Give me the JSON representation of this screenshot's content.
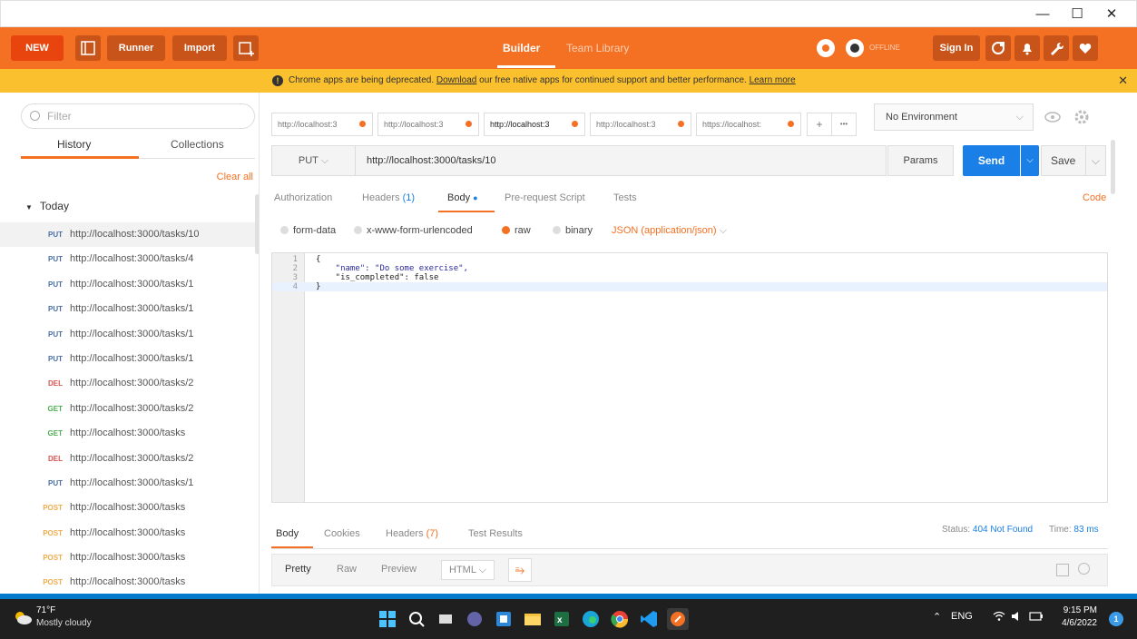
{
  "window": {
    "minimize": "—",
    "maximize": "☐",
    "close": "✕"
  },
  "toolbar": {
    "new_label": "NEW",
    "runner_label": "Runner",
    "import_label": "Import",
    "builder_label": "Builder",
    "team_library_label": "Team Library",
    "offline_label": "OFFLINE",
    "sign_in_label": "Sign In",
    "accent": "#f47023"
  },
  "banner": {
    "icon": "!",
    "text_before": "Chrome apps are being deprecated. ",
    "download_link": "Download",
    "text_after": " our free native apps for continued support and better performance. ",
    "learn_more_link": "Learn more",
    "close": "✕"
  },
  "sidebar": {
    "filter_placeholder": "Filter",
    "tabs": [
      "History",
      "Collections"
    ],
    "clear_all": "Clear all",
    "group_label": "Today",
    "history": [
      {
        "method": "PUT",
        "url": "http://localhost:3000/tasks/10"
      },
      {
        "method": "PUT",
        "url": "http://localhost:3000/tasks/4"
      },
      {
        "method": "PUT",
        "url": "http://localhost:3000/tasks/1"
      },
      {
        "method": "PUT",
        "url": "http://localhost:3000/tasks/1"
      },
      {
        "method": "PUT",
        "url": "http://localhost:3000/tasks/1"
      },
      {
        "method": "PUT",
        "url": "http://localhost:3000/tasks/1"
      },
      {
        "method": "DEL",
        "url": "http://localhost:3000/tasks/2"
      },
      {
        "method": "GET",
        "url": "http://localhost:3000/tasks/2"
      },
      {
        "method": "GET",
        "url": "http://localhost:3000/tasks"
      },
      {
        "method": "DEL",
        "url": "http://localhost:3000/tasks/2"
      },
      {
        "method": "PUT",
        "url": "http://localhost:3000/tasks/1"
      },
      {
        "method": "POST",
        "url": "http://localhost:3000/tasks"
      },
      {
        "method": "POST",
        "url": "http://localhost:3000/tasks"
      },
      {
        "method": "POST",
        "url": "http://localhost:3000/tasks"
      },
      {
        "method": "POST",
        "url": "http://localhost:3000/tasks"
      }
    ]
  },
  "request_tabs": [
    {
      "label": "http://localhost:3"
    },
    {
      "label": "http://localhost:3"
    },
    {
      "label": "http://localhost:3"
    },
    {
      "label": "http://localhost:3"
    },
    {
      "label": "https://localhost:"
    }
  ],
  "tab_actions": {
    "add": "+",
    "more": "•••"
  },
  "environment": {
    "selected": "No Environment"
  },
  "request": {
    "method": "PUT",
    "url": "http://localhost:3000/tasks/10",
    "params_label": "Params",
    "send_label": "Send",
    "save_label": "Save"
  },
  "subtabs": {
    "authorization": "Authorization",
    "headers": "Headers",
    "headers_count": "(1)",
    "body": "Body",
    "pre_request": "Pre-request Script",
    "tests": "Tests",
    "code": "Code"
  },
  "body_modes": {
    "form_data": "form-data",
    "urlencoded": "x-www-form-urlencoded",
    "raw": "raw",
    "binary": "binary",
    "content_type": "JSON (application/json)"
  },
  "editor": {
    "lines": [
      {
        "n": "1",
        "text": "{"
      },
      {
        "n": "2",
        "text": "    \"name\": \"Do some exercise\","
      },
      {
        "n": "3",
        "text": "    \"is_completed\": false"
      },
      {
        "n": "4",
        "text": "}"
      }
    ]
  },
  "response": {
    "tabs": {
      "body": "Body",
      "cookies": "Cookies",
      "headers": "Headers",
      "headers_count": "(7)",
      "test_results": "Test Results"
    },
    "status_label": "Status:",
    "status_value": "404 Not Found",
    "time_label": "Time:",
    "time_value": "83 ms",
    "view": {
      "pretty": "Pretty",
      "raw": "Raw",
      "preview": "Preview",
      "format": "HTML"
    }
  },
  "taskbar": {
    "temp": "71°F",
    "weather": "Mostly cloudy",
    "lang": "ENG",
    "time": "9:15 PM",
    "date": "4/6/2022",
    "notif": "1"
  }
}
